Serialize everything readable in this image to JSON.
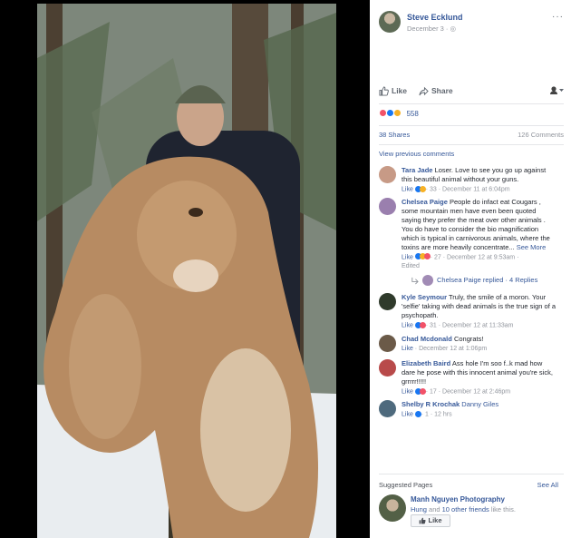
{
  "post": {
    "author": "Steve Ecklund",
    "date": "December 3 · ◎",
    "more": "···"
  },
  "actions": {
    "like": "Like",
    "share": "Share"
  },
  "reactions": {
    "count": "558",
    "colors": [
      "#f25268",
      "#1877f2",
      "#f7b125"
    ]
  },
  "counts": {
    "shares": "38 Shares",
    "comments": "126 Comments"
  },
  "view_previous": "View previous comments",
  "comments": [
    {
      "name": "Tara Jade",
      "text": "Loser. Love to see you go up against this beautiful animal without your guns.",
      "like": "Like",
      "meta": "· 33 · December 11 at 6:04pm",
      "avatar_color": "#c79a86"
    },
    {
      "name": "Chelsea Paige",
      "text": "People do infact eat Cougars , some mountain men have even been quoted saying they prefer the meat over other animals . You do have to consider the bio magnification which is typical in carnivorous animals, where the toxins are more heavily concentrate...",
      "see_more": "See More",
      "like": "Like",
      "meta": "· 27 · December 12 at 9:53am ·",
      "edited": "Edited",
      "avatar_color": "#9a7fae"
    },
    {
      "name": "Kyle Seymour",
      "text": "Truly, the smile of a moron. Your 'selfie' taking with dead animals is the true sign of a psychopath.",
      "like": "Like",
      "meta": "· 31 · December 12 at 11:33am",
      "avatar_color": "#2f3a2b"
    },
    {
      "name": "Chad Mcdonald",
      "text": "Congrats!",
      "like": "Like",
      "meta": "· December 12 at 1:06pm",
      "avatar_color": "#6b5a48"
    },
    {
      "name": "Elizabeth Baird",
      "text": "Ass hole I'm soo f..k mad how dare he pose with this innocent animal you're sick, grrrrr!!!!!",
      "like": "Like",
      "meta": "· 17 · December 12 at 2:46pm",
      "avatar_color": "#b84a4a"
    },
    {
      "name": "Shelby R Krochak",
      "tag": "Danny Giles",
      "like": "Like",
      "meta": "· 1 · 12 hrs",
      "avatar_color": "#4e6a7d"
    }
  ],
  "replies": {
    "text": "Chelsea Paige replied · 4 Replies"
  },
  "suggested": {
    "title": "Suggested Pages",
    "see_all": "See All",
    "page_name": "Manh Nguyen Photography",
    "friend": "Hung",
    "friends_rest": " and ",
    "others": "10 other friends",
    "tail": " like this.",
    "like_button": "Like"
  }
}
